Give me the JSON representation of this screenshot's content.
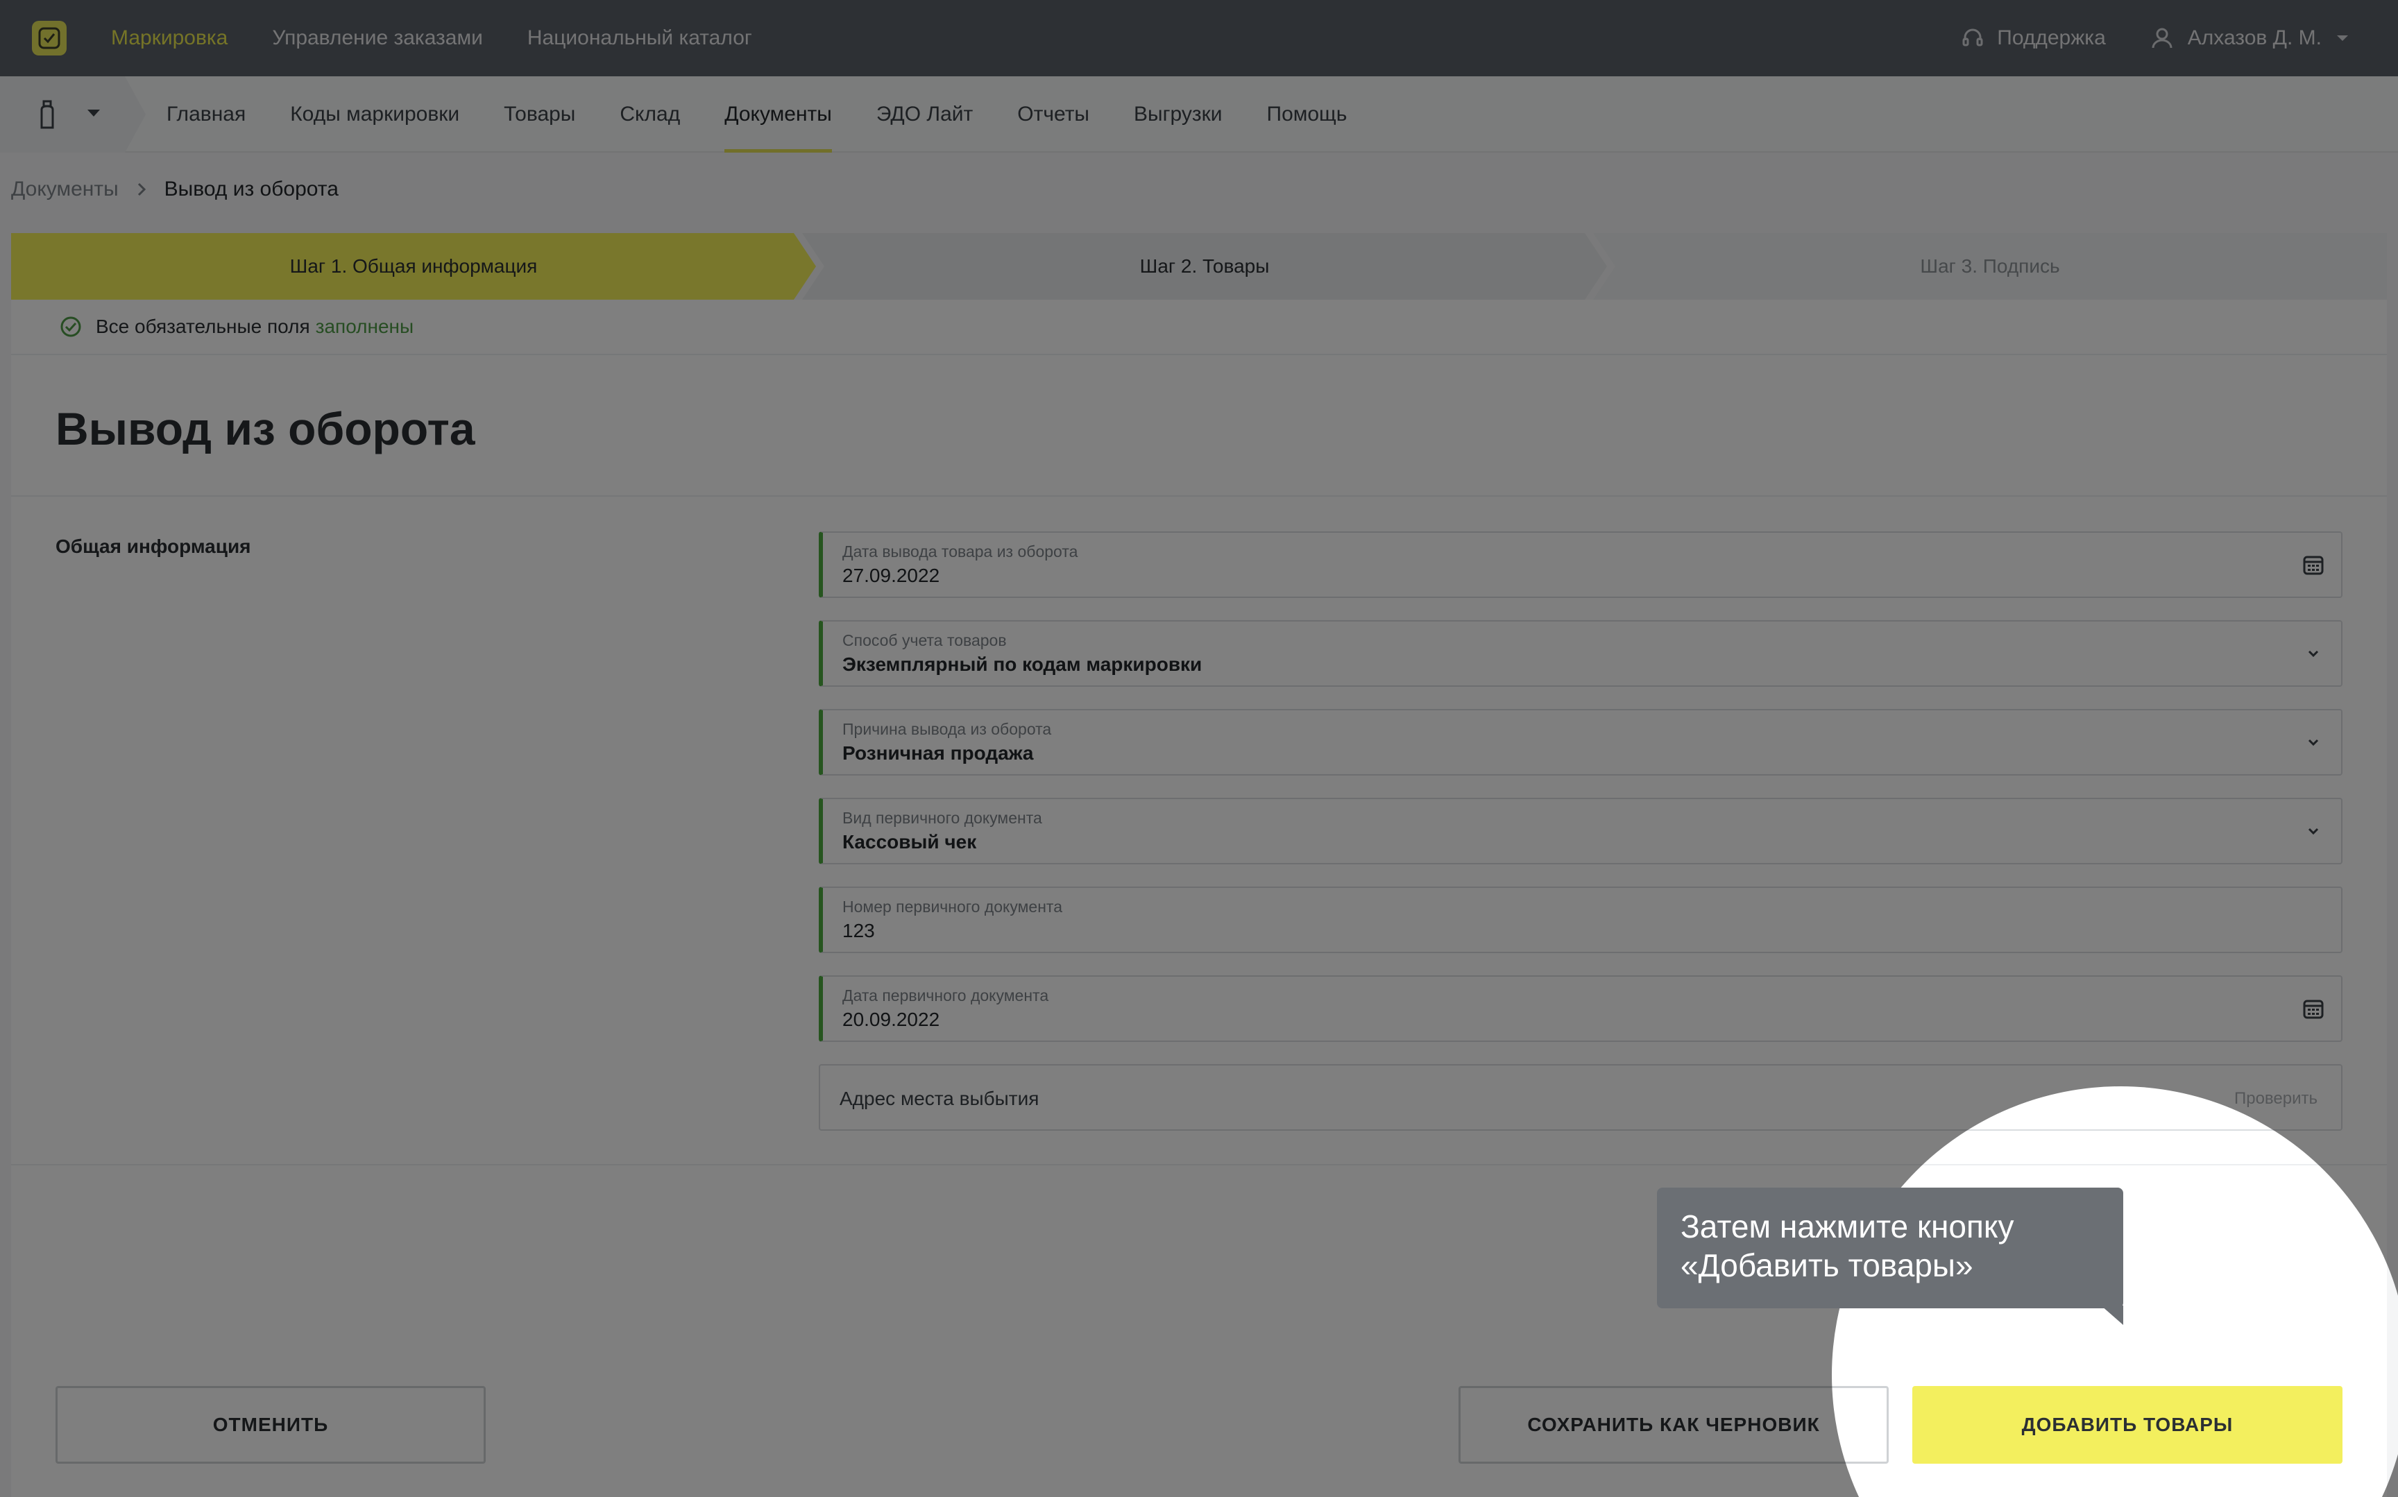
{
  "topbar": {
    "nav": [
      "Маркировка",
      "Управление заказами",
      "Национальный каталог"
    ],
    "support_label": "Поддержка",
    "user_name": "Алхазов Д. М."
  },
  "subnav": {
    "items": [
      "Главная",
      "Коды маркировки",
      "Товары",
      "Склад",
      "Документы",
      "ЭДО Лайт",
      "Отчеты",
      "Выгрузки",
      "Помощь"
    ],
    "active_index": 4
  },
  "breadcrumb": {
    "parent": "Документы",
    "current": "Вывод из оборота"
  },
  "stepper": {
    "steps": [
      "Шаг 1. Общая информация",
      "Шаг 2. Товары",
      "Шаг 3. Подпись"
    ]
  },
  "validation": {
    "text": "Все обязательные поля",
    "status_word": "заполнены"
  },
  "page_title": "Вывод из оборота",
  "section_label": "Общая информация",
  "fields": [
    {
      "label": "Дата вывода товара из оборота",
      "value": "27.09.2022",
      "icon": "calendar-icon"
    },
    {
      "label": "Способ учета товаров",
      "value": "Экземплярный по кодам маркировки",
      "icon": "chevron-down-icon"
    },
    {
      "label": "Причина вывода из оборота",
      "value": "Розничная продажа",
      "icon": "chevron-down-icon"
    },
    {
      "label": "Вид первичного документа",
      "value": "Кассовый чек",
      "icon": "chevron-down-icon"
    },
    {
      "label": "Номер первичного документа",
      "value": "123"
    },
    {
      "label": "Дата первичного документа",
      "value": "20.09.2022",
      "icon": "calendar-icon"
    }
  ],
  "address_field": {
    "placeholder": "Адрес места выбытия",
    "action": "Проверить"
  },
  "buttons": {
    "cancel": "ОТМЕНИТЬ",
    "save_draft": "СОХРАНИТЬ КАК ЧЕРНОВИК",
    "add_goods": "ДОБАВИТЬ ТОВАРЫ"
  },
  "tooltip": {
    "line1": "Затем нажмите кнопку",
    "line2": "«Добавить товары»"
  },
  "colors": {
    "accent_yellow": "#f3ef5e",
    "topbar": "#5b6068",
    "valid_green": "#4caa3f",
    "tooltip_bg": "#6b6f74"
  }
}
